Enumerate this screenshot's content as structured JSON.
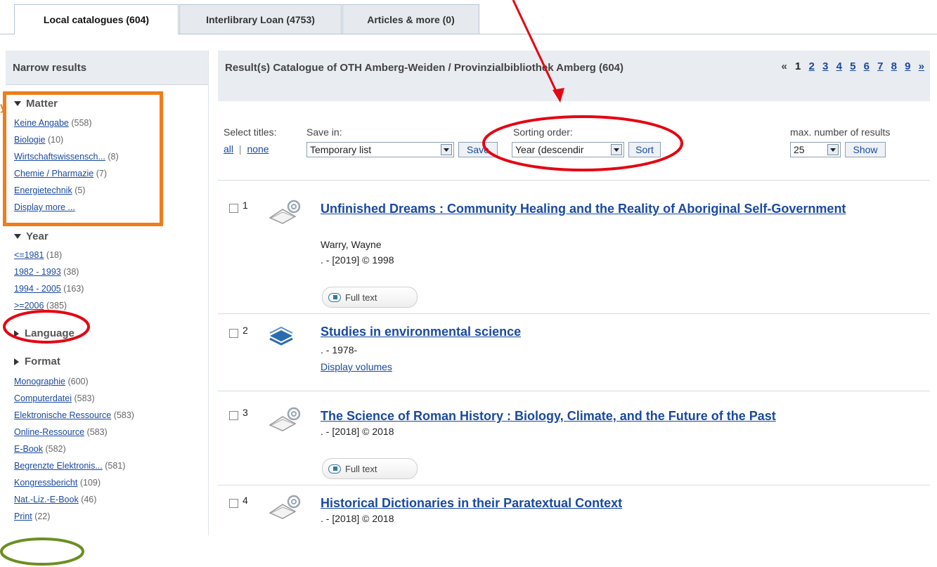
{
  "tabs": [
    {
      "label": "Local catalogues (604)"
    },
    {
      "label": "Interlibrary Loan (4753)"
    },
    {
      "label": "Articles & more (0)"
    }
  ],
  "sidebar": {
    "title": "Narrow results",
    "fragment": "y",
    "matter": {
      "title": "Matter",
      "items": [
        {
          "label": "Keine Angabe",
          "count": "(558)"
        },
        {
          "label": "Biologie",
          "count": "(10)"
        },
        {
          "label": "Wirtschaftswissensch...",
          "count": "(8)"
        },
        {
          "label": "Chemie / Pharmazie",
          "count": "(7)"
        },
        {
          "label": "Energietechnik",
          "count": "(5)"
        }
      ],
      "more": "Display more ..."
    },
    "year": {
      "title": "Year",
      "items": [
        {
          "label": "<=1981",
          "count": "(18)"
        },
        {
          "label": "1982 - 1993",
          "count": "(38)"
        },
        {
          "label": "1994 - 2005",
          "count": "(163)"
        },
        {
          "label": ">=2006",
          "count": "(385)"
        }
      ]
    },
    "language": {
      "title": "Language"
    },
    "format": {
      "title": "Format",
      "items": [
        {
          "label": "Monographie",
          "count": "(600)"
        },
        {
          "label": "Computerdatei",
          "count": "(583)"
        },
        {
          "label": "Elektronische Ressource",
          "count": "(583)"
        },
        {
          "label": "Online-Ressource",
          "count": "(583)"
        },
        {
          "label": "E-Book",
          "count": "(582)"
        },
        {
          "label": "Begrenzte Elektronis...",
          "count": "(581)"
        },
        {
          "label": "Kongressbericht",
          "count": "(109)"
        },
        {
          "label": "Nat.-Liz.-E-Book",
          "count": "(46)"
        },
        {
          "label": "Print",
          "count": "(22)"
        }
      ]
    }
  },
  "main": {
    "result_title": "Result(s) Catalogue of OTH Amberg-Weiden / Provinzialbibliothek Amberg (604)",
    "pager": {
      "prev": "«",
      "current": "1",
      "pages": [
        "2",
        "3",
        "4",
        "5",
        "6",
        "7",
        "8",
        "9"
      ],
      "next": "»"
    },
    "controls": {
      "select_titles_label": "Select titles:",
      "all": "all",
      "separator": "|",
      "none": "none",
      "save_in_label": "Save in:",
      "save_in_value": "Temporary list",
      "save_button": "Save",
      "sorting_label": "Sorting order:",
      "sorting_value": "Year (descendir",
      "sort_button": "Sort",
      "max_label": "max. number of results",
      "max_value": "25",
      "show_button": "Show"
    },
    "results": [
      {
        "num": "1",
        "title": "Unfinished Dreams : Community Healing and the Reality of Aboriginal Self-Government",
        "author": "Warry, Wayne",
        "date": ". - [2019] © 1998",
        "fulltext": "Full text",
        "icon": "ebook-icon"
      },
      {
        "num": "2",
        "title": "Studies in environmental science",
        "date": ". - 1978-",
        "volumes": "Display volumes",
        "icon": "book-series-icon"
      },
      {
        "num": "3",
        "title": "The Science of Roman History : Biology, Climate, and the Future of the Past",
        "date": ". - [2018] © 2018",
        "fulltext": "Full text",
        "icon": "ebook-icon"
      },
      {
        "num": "4",
        "title": "Historical Dictionaries in their Paratextual Context",
        "date": ". - [2018] © 2018",
        "icon": "ebook-icon"
      }
    ]
  },
  "annotation_colors": {
    "red": "#e30613",
    "orange": "#f07d1a",
    "green": "#6b8e23"
  }
}
